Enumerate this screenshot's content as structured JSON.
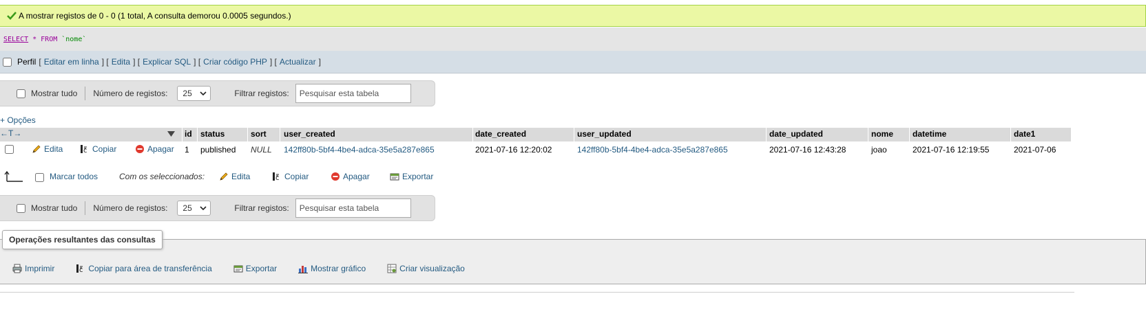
{
  "success": {
    "message": "A mostrar registos de 0 - 0 (1 total, A consulta demorou 0.0005 segundos.)"
  },
  "sql": {
    "select": "SELECT",
    "star": "*",
    "from": "FROM",
    "table": "`nome`"
  },
  "profile": {
    "label": "Perfil",
    "links": [
      "Editar em linha",
      "Edita",
      "Explicar SQL",
      "Criar código PHP",
      "Actualizar"
    ]
  },
  "nav": {
    "show_all": "Mostrar tudo",
    "rows_label": "Número de registos:",
    "rows_value": "25",
    "filter_label": "Filtrar registos:",
    "filter_placeholder": "Pesquisar esta tabela"
  },
  "table": {
    "options_link": "+ Opções",
    "arrows": "←T→",
    "headers": [
      "id",
      "status",
      "sort",
      "user_created",
      "date_created",
      "user_updated",
      "date_updated",
      "nome",
      "datetime",
      "date1"
    ],
    "row_actions": {
      "edit": "Edita",
      "copy": "Copiar",
      "delete": "Apagar"
    },
    "rows": [
      [
        "1",
        "published",
        "NULL",
        "142ff80b-5bf4-4be4-adca-35e5a287e865",
        "2021-07-16 12:20:02",
        "142ff80b-5bf4-4be4-adca-35e5a287e865",
        "2021-07-16 12:43:28",
        "joao",
        "2021-07-16 12:19:55",
        "2021-07-06"
      ]
    ]
  },
  "bulk": {
    "mark_all": "Marcar todos",
    "with_selected": "Com os seleccionados:",
    "edit": "Edita",
    "copy": "Copiar",
    "delete": "Apagar",
    "export": "Exportar"
  },
  "operations": {
    "legend": "Operações resultantes das consultas",
    "print": "Imprimir",
    "copy_clipboard": "Copiar para área de transferência",
    "export": "Exportar",
    "show_chart": "Mostrar gráfico",
    "create_view": "Criar visualização"
  },
  "colors": {
    "success_bg": "#ebf8a4",
    "link": "#235a81",
    "header_bg": "#dadada",
    "profile_bg": "#d5dee6"
  }
}
